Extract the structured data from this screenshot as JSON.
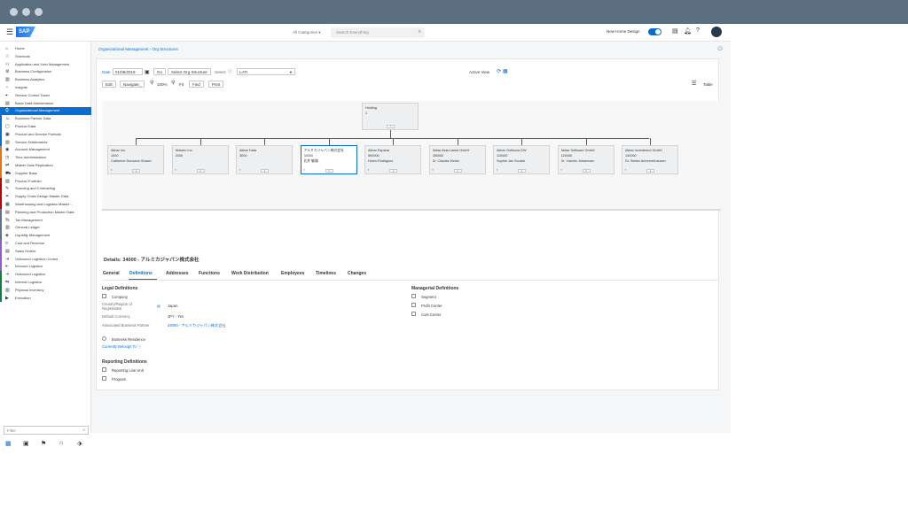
{
  "shellbar": {
    "category": "All Categories",
    "search_placeholder": "Search Everything",
    "new_design_label": "New Home Design"
  },
  "nav": [
    {
      "label": "Home",
      "icon": "home-icon"
    },
    {
      "label": "Shortcuts",
      "icon": "bookmark-icon"
    },
    {
      "label": "Application and User Management",
      "icon": "users-icon"
    },
    {
      "label": "Business Configuration",
      "icon": "gear-icon"
    },
    {
      "label": "Business Analytics",
      "icon": "chart-icon"
    },
    {
      "label": "Insights",
      "icon": "insight-icon"
    },
    {
      "label": "Service Control Tower",
      "icon": "tower-icon"
    },
    {
      "label": "Basic Data Maintenance",
      "icon": "data-icon"
    },
    {
      "label": "Organizational Management",
      "icon": "org-icon"
    },
    {
      "label": "Business Partner Data",
      "icon": "partner-icon"
    },
    {
      "label": "Product Data",
      "icon": "product-icon"
    },
    {
      "label": "Product and Service Portfolio",
      "icon": "portfolio-icon"
    },
    {
      "label": "Service Entitlements",
      "icon": "entitlement-icon"
    },
    {
      "label": "Account Management",
      "icon": "account-icon"
    },
    {
      "label": "Time Administration",
      "icon": "time-icon"
    },
    {
      "label": "Master Data Replication",
      "icon": "replication-icon"
    },
    {
      "label": "Supplier Base",
      "icon": "supplier-icon"
    },
    {
      "label": "Product Portfolio",
      "icon": "portfolio2-icon"
    },
    {
      "label": "Sourcing and Contracting",
      "icon": "sourcing-icon"
    },
    {
      "label": "Supply Chain Design Master Data",
      "icon": "supply-icon"
    },
    {
      "label": "Warehousing and Logistics Master ...",
      "icon": "warehouse-icon"
    },
    {
      "label": "Planning and Production Master Data",
      "icon": "planning-icon"
    },
    {
      "label": "Tax Management",
      "icon": "tax-icon"
    },
    {
      "label": "General Ledger",
      "icon": "ledger-icon"
    },
    {
      "label": "Liquidity Management",
      "icon": "liquidity-icon"
    },
    {
      "label": "Cost and Revenue",
      "icon": "cost-icon"
    },
    {
      "label": "Sales Orders",
      "icon": "sales-icon"
    },
    {
      "label": "Outbound Logistics Control",
      "icon": "outbound-icon"
    },
    {
      "label": "Inbound Logistics",
      "icon": "inbound-icon"
    },
    {
      "label": "Outbound Logistics",
      "icon": "outbound2-icon"
    },
    {
      "label": "Internal Logistics",
      "icon": "internal-icon"
    },
    {
      "label": "Physical Inventory",
      "icon": "inventory-icon"
    },
    {
      "label": "Execution",
      "icon": "execution-icon"
    }
  ],
  "nav_active_index": 8,
  "filter_placeholder": "Filter",
  "breadcrumb": "Organizational Management › Org Structures",
  "toolbar": {
    "date_label": "Date",
    "date_value": "01/05/2019",
    "go_label": "Go",
    "structure_select": "Select Org Structure",
    "select_label": "Select",
    "select_value": "LATI",
    "edit_label": "Edit",
    "navigate_label": "Navigate_",
    "zoom_value": "100%",
    "fit_label": "Fit",
    "find_label": "Find",
    "print_label": "Print",
    "active_view_label": "Active View",
    "table_label": "Table"
  },
  "org_chart": {
    "root": {
      "line1": "Holding",
      "line2": "1"
    },
    "children": [
      {
        "line1": "Akbar Inc.",
        "line2": "1000",
        "line3": "Catherine Duncane-Shawn"
      },
      {
        "line1": "Akbarin Inc.",
        "line2": "2000",
        "line3": ""
      },
      {
        "line1": "Akbar Data",
        "line2": "3000",
        "line3": ""
      },
      {
        "line1": "アルミカジャパン株式会社",
        "line2": "34000",
        "line3": "北井 敏雄"
      },
      {
        "line1": "Akbar Espana",
        "line2": "500000",
        "line3": "Helen Rodriguez"
      },
      {
        "line1": "Akbar Asia-Lanka GmbH",
        "line2": "280000",
        "line3": "Dr. Claudia Weise"
      },
      {
        "line1": "Akbar Gulfnova DW",
        "line2": "110000",
        "line3": "Sophie Jan Scutari"
      },
      {
        "line1": "Akbar Software GmbH",
        "line2": "120000",
        "line3": "Dr. Yasmin Johannsen"
      },
      {
        "line1": "Akbar Investment GmbH",
        "line2": "140000",
        "line3": "Dr. Stefan Amremerhausen"
      }
    ]
  },
  "details": {
    "title": "Details: 34000 - アルミカジャパン株式会社",
    "tabs": [
      "General",
      "Definitions",
      "Addresses",
      "Functions",
      "Work Distribution",
      "Employees",
      "Timelines",
      "Changes"
    ],
    "active_tab": 1,
    "legal": {
      "heading": "Legal Definitions",
      "company_label": "Company",
      "country_label": "Country/Region of Registration",
      "country_value": "Japan",
      "currency_label": "Default Currency",
      "currency_value": "JPY - Yen",
      "partner_label": "Associated Business Partner",
      "partner_value": "34000 - アルミカジャパン株式会社",
      "residence_label": "Business Residence",
      "belongs_label": "Currently Belongs To"
    },
    "managerial": {
      "heading": "Managerial Definitions",
      "items": [
        "Segment",
        "Profit Center",
        "Cost Center"
      ]
    },
    "reporting": {
      "heading": "Reporting Definitions",
      "items": [
        "Reporting Line Unit",
        "Program"
      ]
    }
  },
  "colors": {
    "accent": "#0a6ed1",
    "chrome": "#5b6f80"
  }
}
